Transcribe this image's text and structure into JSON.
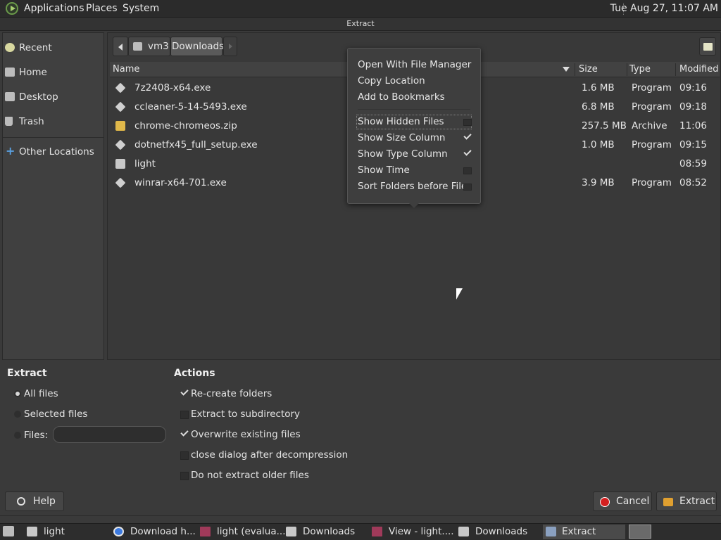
{
  "topbar": {
    "menus": [
      "Applications",
      "Places",
      "System"
    ],
    "clock": "Tue Aug 27, 11:07 AM"
  },
  "window": {
    "title": "Extract"
  },
  "sidebar": {
    "items": [
      {
        "label": "Recent",
        "icon": "clock-icon"
      },
      {
        "label": "Home",
        "icon": "home-icon"
      },
      {
        "label": "Desktop",
        "icon": "desktop-icon"
      },
      {
        "label": "Trash",
        "icon": "trash-icon"
      },
      {
        "label": "Other Locations",
        "icon": "plus-icon"
      }
    ]
  },
  "pathbar": {
    "segments": [
      "vm3",
      "Downloads"
    ],
    "active": "Downloads"
  },
  "columns": {
    "name": "Name",
    "size": "Size",
    "type": "Type",
    "modified": "Modified"
  },
  "files": [
    {
      "name": "7z2408-x64.exe",
      "size": "1.6 MB",
      "type": "Program",
      "modified": "09:16",
      "icon": "exe-icon"
    },
    {
      "name": "ccleaner-5-14-5493.exe",
      "size": "6.8 MB",
      "type": "Program",
      "modified": "09:18",
      "icon": "exe-icon"
    },
    {
      "name": "chrome-chromeos.zip",
      "size": "257.5 MB",
      "type": "Archive",
      "modified": "11:06",
      "icon": "archive-icon"
    },
    {
      "name": "dotnetfx45_full_setup.exe",
      "size": "1.0 MB",
      "type": "Program",
      "modified": "09:15",
      "icon": "exe-icon"
    },
    {
      "name": "light",
      "size": "",
      "type": "",
      "modified": "08:59",
      "icon": "folder-icon"
    },
    {
      "name": "winrar-x64-701.exe",
      "size": "3.9 MB",
      "type": "Program",
      "modified": "08:52",
      "icon": "exe-icon"
    }
  ],
  "popover": {
    "actions": [
      "Open With File Manager",
      "Copy Location",
      "Add to Bookmarks"
    ],
    "toggles": [
      {
        "label": "Show Hidden Files",
        "checked": false
      },
      {
        "label": "Show Size Column",
        "checked": true
      },
      {
        "label": "Show Type Column",
        "checked": true
      },
      {
        "label": "Show Time",
        "checked": false
      },
      {
        "label": "Sort Folders before Files",
        "checked": false
      }
    ]
  },
  "extract": {
    "title": "Extract",
    "all_files": "All files",
    "selected_files": "Selected files",
    "files_label": "Files:",
    "files_value": ""
  },
  "actions": {
    "title": "Actions",
    "options": [
      {
        "label": "Re-create folders",
        "checked": true
      },
      {
        "label": "Extract to subdirectory",
        "checked": false
      },
      {
        "label": "Overwrite existing files",
        "checked": true
      },
      {
        "label": "close dialog after decompression",
        "checked": false
      },
      {
        "label": "Do not extract older files",
        "checked": false
      }
    ]
  },
  "buttons": {
    "help": "Help",
    "cancel": "Cancel",
    "extract": "Extract"
  },
  "taskbar": {
    "tasks": [
      {
        "label": "light",
        "icon": "folder-icon"
      },
      {
        "label": "Download h...",
        "icon": "chrome-icon"
      },
      {
        "label": "light (evalua...",
        "icon": "winrar-icon"
      },
      {
        "label": "Downloads",
        "icon": "folder-icon"
      },
      {
        "label": "View - light....",
        "icon": "winrar-icon"
      },
      {
        "label": "Downloads",
        "icon": "folder-icon"
      },
      {
        "label": "Extract",
        "icon": "extract-icon"
      }
    ]
  },
  "colors": {
    "accent_red": "#d42020",
    "checked": "#dddddd"
  }
}
